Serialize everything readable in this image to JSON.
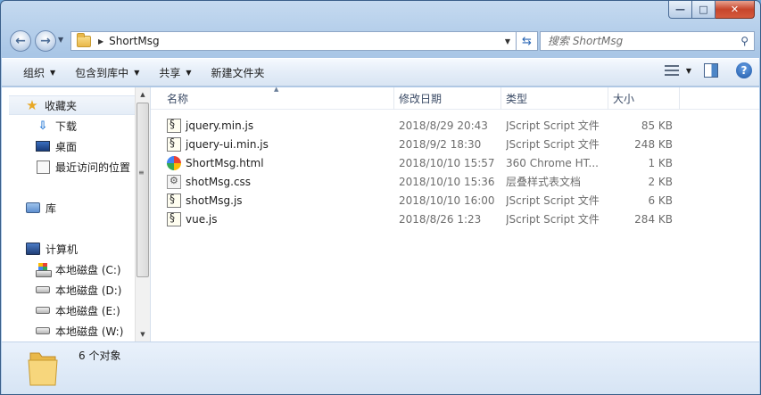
{
  "window": {
    "controls": {
      "minimize": "—",
      "maximize": "□",
      "close": "✕"
    }
  },
  "address": {
    "path": "ShortMsg",
    "search_placeholder": "搜索 ShortMsg"
  },
  "toolbar": {
    "organize": "组织",
    "include_in_library": "包含到库中",
    "share": "共享",
    "new_folder": "新建文件夹"
  },
  "nav": {
    "favorites": "收藏夹",
    "downloads": "下载",
    "desktop": "桌面",
    "recent": "最近访问的位置",
    "libraries": "库",
    "computer": "计算机",
    "drive_c": "本地磁盘 (C:)",
    "drive_d": "本地磁盘 (D:)",
    "drive_e": "本地磁盘 (E:)",
    "drive_w": "本地磁盘 (W:)"
  },
  "columns": {
    "name": "名称",
    "date": "修改日期",
    "type": "类型",
    "size": "大小"
  },
  "files": [
    {
      "name": "jquery.min.js",
      "date": "2018/8/29 20:43",
      "type": "JScript Script 文件",
      "size": "85 KB",
      "icon": "js"
    },
    {
      "name": "jquery-ui.min.js",
      "date": "2018/9/2 18:30",
      "type": "JScript Script 文件",
      "size": "248 KB",
      "icon": "js"
    },
    {
      "name": "ShortMsg.html",
      "date": "2018/10/10 15:57",
      "type": "360 Chrome HT...",
      "size": "1 KB",
      "icon": "html"
    },
    {
      "name": "shotMsg.css",
      "date": "2018/10/10 15:36",
      "type": "层叠样式表文档",
      "size": "2 KB",
      "icon": "css"
    },
    {
      "name": "shotMsg.js",
      "date": "2018/10/10 16:00",
      "type": "JScript Script 文件",
      "size": "6 KB",
      "icon": "js"
    },
    {
      "name": "vue.js",
      "date": "2018/8/26 1:23",
      "type": "JScript Script 文件",
      "size": "284 KB",
      "icon": "js"
    }
  ],
  "status": {
    "count": "6 个对象"
  }
}
